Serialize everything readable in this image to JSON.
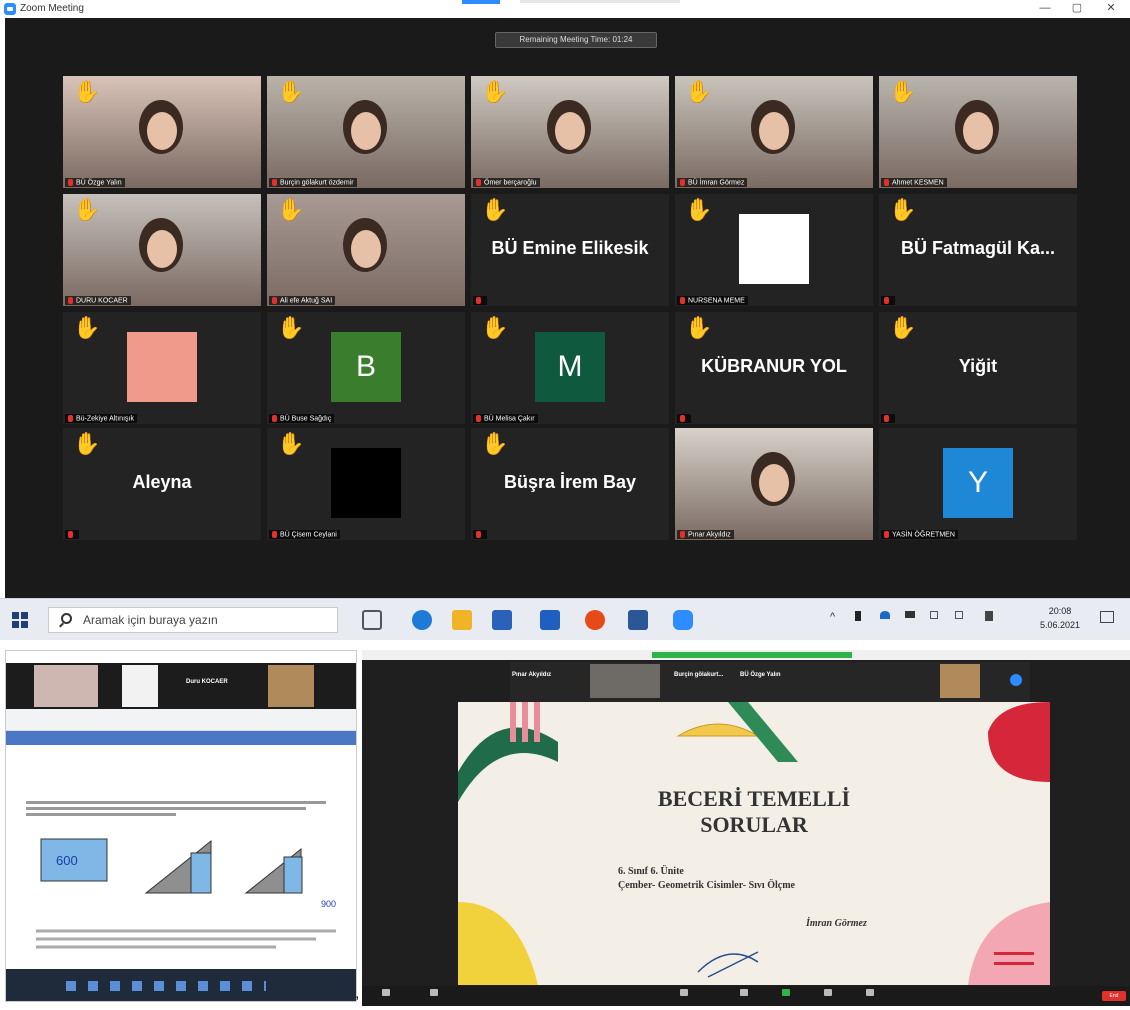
{
  "window": {
    "title": "Zoom Meeting",
    "min": "—",
    "max": "▢",
    "close": "✕"
  },
  "meeting": {
    "timer": "Remaining Meeting Time: 01:24",
    "hand_icon": "✋",
    "participants": [
      {
        "name": "BÜ Özge Yalın",
        "display": "",
        "video": true,
        "hand": true,
        "active": true,
        "color": "#d9c3b8"
      },
      {
        "name": "Burçin gölakurt özdemir",
        "display": "",
        "video": true,
        "hand": true,
        "color": "#b9b3aa"
      },
      {
        "name": "Ömer berçaroğlu",
        "display": "",
        "video": true,
        "hand": true,
        "color": "#cfcac2"
      },
      {
        "name": "BÜ İmran Görmez",
        "display": "",
        "video": true,
        "hand": true,
        "color": "#c8c4bc"
      },
      {
        "name": "Ahmet KESMEN",
        "display": "",
        "video": true,
        "hand": true,
        "color": "#b8b4ad"
      },
      {
        "name": "DURU KOCAER",
        "display": "",
        "video": true,
        "hand": true,
        "color": "#c6c0bb"
      },
      {
        "name": "Ali efe Aktuğ SAI",
        "display": "",
        "video": true,
        "hand": true,
        "color": "#a89a94"
      },
      {
        "name": "",
        "display": "BÜ Emine Elikesik",
        "video": false,
        "hand": true
      },
      {
        "name": "NURSENA MEME",
        "display": "",
        "video": false,
        "hand": true,
        "avatar_color": "#ffffff"
      },
      {
        "name": "",
        "display": "BÜ Fatmagül Ka...",
        "video": false,
        "hand": true
      },
      {
        "name": "Bü-Zekiye Altınışık",
        "display": "",
        "video": false,
        "hand": true,
        "avatar_color": "#ef9a8a"
      },
      {
        "name": "BÜ Buse Sağdıç",
        "display": "",
        "video": false,
        "hand": true,
        "avatar_color": "#3a7d2c",
        "letter": "B"
      },
      {
        "name": "BÜ Melisa Çakır",
        "display": "",
        "video": false,
        "hand": true,
        "avatar_color": "#0f5a3e",
        "letter": "M"
      },
      {
        "name": "",
        "display": "KÜBRANUR YOL",
        "video": false,
        "hand": true
      },
      {
        "name": "",
        "display": "Yiğit",
        "video": false,
        "hand": true
      },
      {
        "name": "",
        "display": "Aleyna",
        "video": false,
        "hand": true
      },
      {
        "name": "BÜ Çisem Ceylani",
        "display": "",
        "video": false,
        "hand": true,
        "avatar_color": "#000000"
      },
      {
        "name": "",
        "display": "Büşra İrem Bay",
        "video": false,
        "hand": true
      },
      {
        "name": "Pınar Akyıldız",
        "display": "",
        "video": true,
        "hand": false,
        "color": "#d8d2ca"
      },
      {
        "name": "YASİN ÖĞRETMEN",
        "display": "",
        "video": false,
        "hand": false,
        "avatar_color": "#1e88d6",
        "letter": "Y"
      }
    ]
  },
  "taskbar": {
    "search_placeholder": "Aramak için buraya yazın",
    "time": "20:08",
    "date": "5.06.2021"
  },
  "slide": {
    "title_line1": "BECERİ TEMELLİ",
    "title_line2": "SORULAR",
    "sub1": "6. Sınıf 6. Ünite",
    "sub2": "Çember- Geometrik Cisimler- Sıvı Ölçme",
    "author": "İmran Görmez"
  },
  "shot_right": {
    "strip_names": [
      "Pınar Akyıldız",
      "Burçin gölakurt...",
      "BÜ Özge Yalın"
    ]
  },
  "shot_left": {
    "strip_name": "Duru KOCAER"
  },
  "separator": ","
}
